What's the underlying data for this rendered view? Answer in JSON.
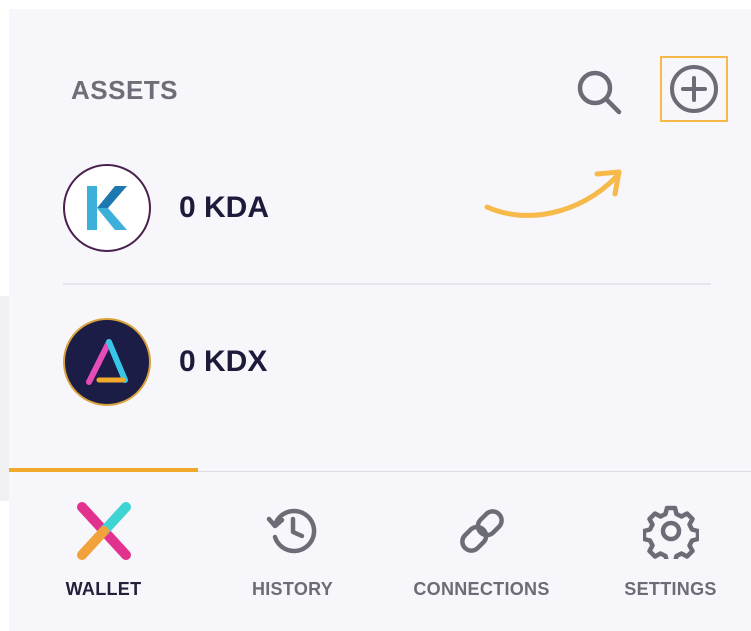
{
  "header": {
    "title": "ASSETS",
    "search_icon": "search-icon",
    "add_icon": "plus-circle-icon",
    "highlight_color": "#f6b94a"
  },
  "assets": [
    {
      "amount": "0 KDA",
      "logo": "kadena-logo"
    },
    {
      "amount": "0 KDX",
      "logo": "kaddex-logo"
    }
  ],
  "tabs": [
    {
      "label": "WALLET",
      "icon": "x-wallet-icon",
      "active": true
    },
    {
      "label": "HISTORY",
      "icon": "history-icon",
      "active": false
    },
    {
      "label": "CONNECTIONS",
      "icon": "link-icon",
      "active": false
    },
    {
      "label": "SETTINGS",
      "icon": "gear-icon",
      "active": false
    }
  ],
  "colors": {
    "accent": "#f0a92b",
    "text_dark": "#1d1b3b",
    "text_muted": "#6c6c76",
    "background": "#f7f6fb"
  }
}
